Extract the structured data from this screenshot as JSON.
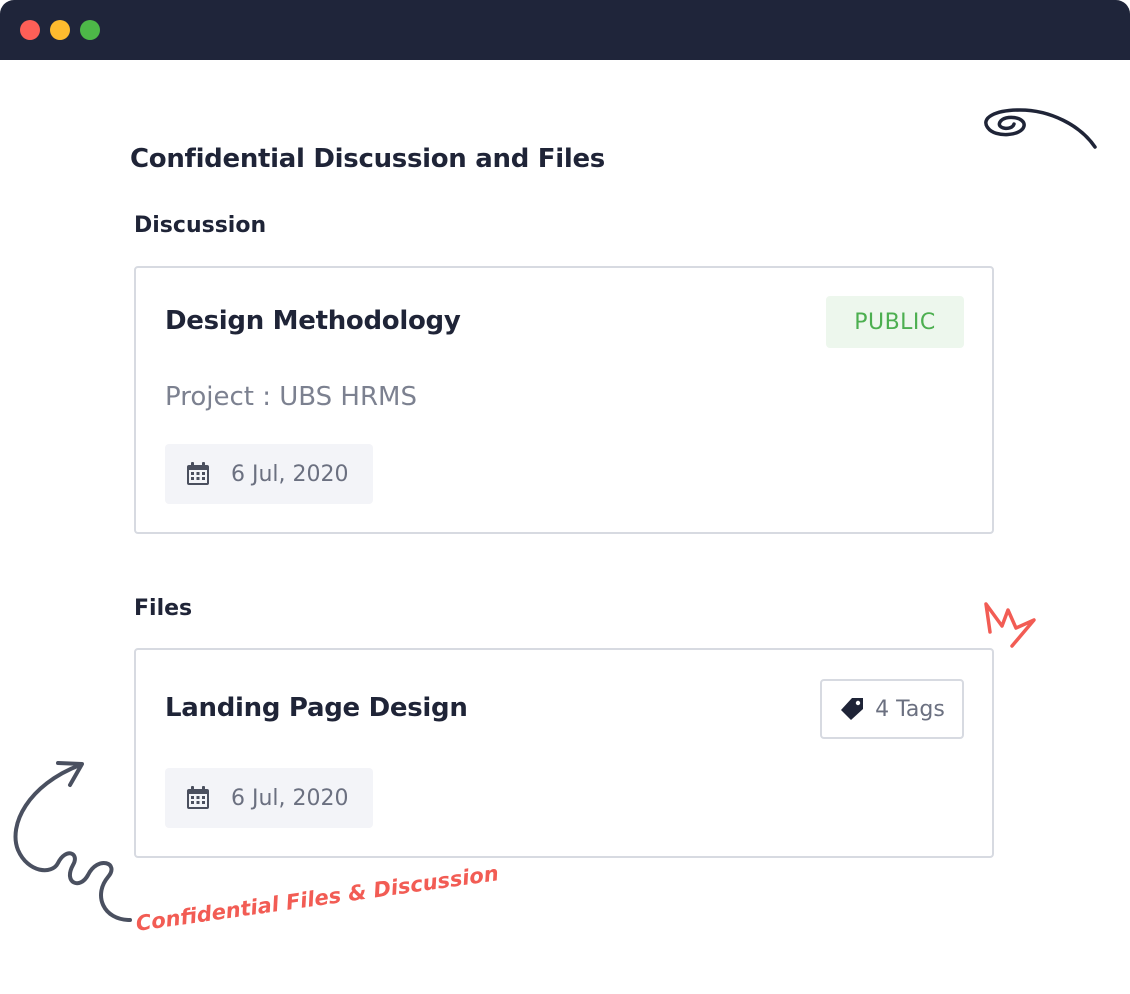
{
  "window": {
    "controls": [
      "close",
      "minimize",
      "maximize"
    ],
    "colors": {
      "close": "#fe5f57",
      "minimize": "#febb2e",
      "maximize": "#4db848"
    }
  },
  "page": {
    "title": "Confidential Discussion and Files"
  },
  "discussion": {
    "section_label": "Discussion",
    "card": {
      "title": "Design Methodology",
      "visibility": "PUBLIC",
      "project": "Project : UBS HRMS",
      "date": "6 Jul, 2020",
      "date_icon": "calendar-icon"
    }
  },
  "files": {
    "section_label": "Files",
    "card": {
      "title": "Landing Page Design",
      "tags_label": "4 Tags",
      "tag_icon": "tag-icon",
      "date": "6 Jul, 2020",
      "date_icon": "calendar-icon"
    }
  },
  "caption": "Confidential Files & Discussion",
  "colors": {
    "titlebar": "#1f253a",
    "text_dark": "#1f2437",
    "text_muted": "#7c8190",
    "public_badge_bg": "#edf7ed",
    "public_badge_text": "#4caf50",
    "accent_coral": "#f25c54"
  }
}
